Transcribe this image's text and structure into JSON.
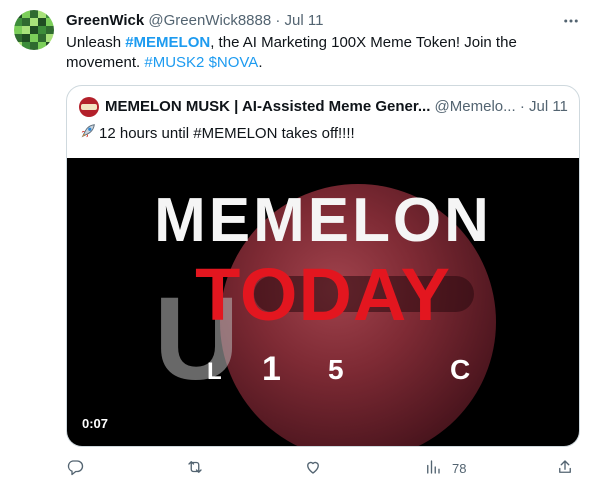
{
  "tweet": {
    "author_name": "GreenWick",
    "author_handle": "@GreenWick8888",
    "separator": "·",
    "time": "Jul 11",
    "text_prefix": "Unleash ",
    "text_tag_bold": "#MEMELON",
    "text_middle": ", the AI Marketing 100X Meme Token! Join the movement. ",
    "text_tag_2": "#MUSK2",
    "text_space": " ",
    "text_tag_3": "$NOVA",
    "text_suffix": ".",
    "avatar_colors": [
      "#2f6b2f",
      "#7ccf5a",
      "#3d8d3a",
      "#a8e27a",
      "#1f4d22"
    ]
  },
  "quote": {
    "author_name": "MEMELON MUSK | AI-Assisted Meme Gener...",
    "author_handle": "@Memelo...",
    "separator": "·",
    "time": "Jul 11",
    "text": "12 hours until #MEMELON takes off!!!!",
    "video": {
      "headline": "MEMELON",
      "subheadline": "TODAY",
      "ghost_letter": "U",
      "lower_1": "L",
      "lower_2": "1",
      "lower_3": "5",
      "lower_4": "C",
      "duration": "0:07"
    }
  },
  "actions": {
    "views_count": "78"
  },
  "colors": {
    "link": "#1d9bf0",
    "muted": "#536471",
    "text": "#0f1419",
    "border": "#cfd9de",
    "red": "#e3161f"
  },
  "icons": [
    "more-icon",
    "rocket-icon",
    "reply-icon",
    "retweet-icon",
    "like-icon",
    "views-icon",
    "share-icon"
  ]
}
